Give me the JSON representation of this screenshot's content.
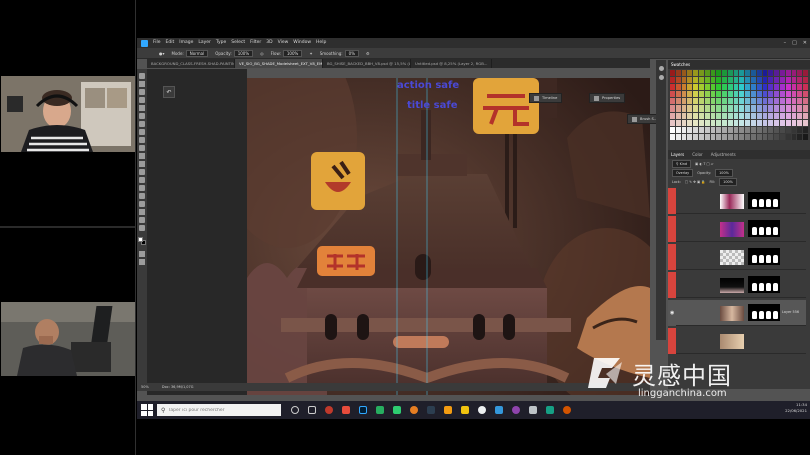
{
  "menu": {
    "items": [
      "File",
      "Edit",
      "Image",
      "Layer",
      "Type",
      "Select",
      "Filter",
      "3D",
      "View",
      "Window",
      "Help"
    ]
  },
  "options": {
    "mode_label": "Mode:",
    "mode_value": "Normal",
    "opacity_label": "Opacity:",
    "opacity_value": "100%",
    "flow_label": "Flow:",
    "flow_value": "100%",
    "smoothing_label": "Smoothing:",
    "smoothing_value": "0%"
  },
  "tabs": [
    {
      "label": "BACKGROUND_CLASS-FRESH-SHAD-PAINTING.psd @ 16,7% (Fill..."
    },
    {
      "label": "VE_SIO_BG_SHADE_Modelsheet_EXT_V8_EMO.psd @ 50% (Layer 556, Layer Mask/8)"
    },
    {
      "label": "BG_SHISE_BACKED_BBH_V8.psd @ 15,5% (Layer 167, RGB..."
    },
    {
      "label": "Untitled.psd @ 8,25% (Layer 2, RGB..."
    }
  ],
  "canvas_overlay": {
    "line1": "action safe",
    "line2": "title safe"
  },
  "floating_panels": [
    {
      "label": "Timeline"
    },
    {
      "label": "Properties"
    },
    {
      "label": "Brush S..."
    }
  ],
  "status": {
    "zoom": "50%",
    "doc": "Doc: 36,9M/1,07G"
  },
  "right_panel": {
    "swatches_tab": "Swatches",
    "tabs": [
      "Layers",
      "Color",
      "Adjustments"
    ],
    "kind_label": "Kind",
    "blend_mode": "Overlay",
    "opacity_label": "Opacity:",
    "opacity_value": "100%",
    "lock_label": "Lock:",
    "fill_label": "Fill:",
    "fill_value": "100%",
    "selected_layer_name": "Layer 556"
  },
  "taskbar": {
    "search_placeholder": "Taper ici pour rechercher",
    "time": "11:34",
    "date": "22/06/2021"
  },
  "watermark": {
    "cn": "灵感中国",
    "url": "lingganchina.com"
  },
  "colors": {
    "photoshop_blue": "#31a8ff",
    "layer_red": "#d7443d",
    "canvas_orange": "#e2a43a"
  }
}
